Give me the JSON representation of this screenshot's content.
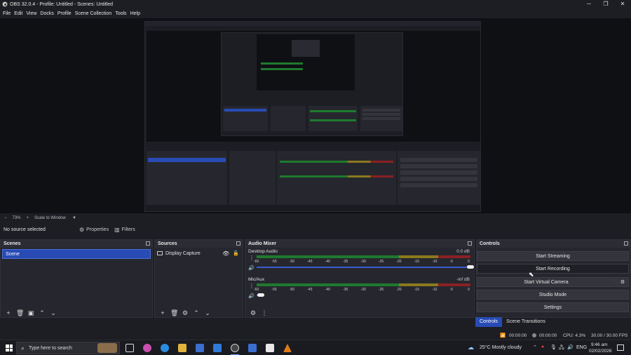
{
  "window": {
    "title": "OBS 32.0.4 - Profile: Untitled - Scenes: Untitled",
    "minimize": "─",
    "maximize": "❐",
    "close": "✕"
  },
  "menu": [
    "File",
    "Edit",
    "View",
    "Docks",
    "Profile",
    "Scene Collection",
    "Tools",
    "Help"
  ],
  "zoom": {
    "minus": "−",
    "level": "73%",
    "plus": "+",
    "mode": "Scale to Window"
  },
  "properties_bar": {
    "no_source": "No source selected",
    "properties": "Properties",
    "filters": "Filters"
  },
  "scenes": {
    "title": "Scenes",
    "items": [
      "Scene"
    ]
  },
  "sources": {
    "title": "Sources",
    "items": [
      {
        "name": "Display Capture"
      }
    ]
  },
  "audio": {
    "title": "Audio Mixer",
    "ticks": [
      "-60",
      "-55",
      "-50",
      "-45",
      "-40",
      "-35",
      "-30",
      "-25",
      "-20",
      "-15",
      "-10",
      "-5",
      "0"
    ],
    "channels": [
      {
        "name": "Desktop Audio",
        "db": "0.0 dB",
        "volume": 1.0
      },
      {
        "name": "Mic/Aux",
        "db": "-inf dB",
        "volume": 0.02
      }
    ]
  },
  "controls": {
    "title": "Controls",
    "buttons": [
      "Start Streaming",
      "Start Recording",
      "Start Virtual Camera",
      "Studio Mode",
      "Settings"
    ],
    "tabs": [
      "Controls",
      "Scene Transitions"
    ]
  },
  "status": {
    "stream_time": "00:00:00",
    "rec_time": "00:00:00",
    "cpu": "CPU: 4.3%",
    "fps": "30.00 / 30.00 FPS"
  },
  "taskbar": {
    "search_placeholder": "Type here to search",
    "weather": "25°C  Mostly cloudy",
    "lang": "ENG",
    "time": "9:46 am",
    "date": "02/02/2026"
  },
  "colors": {
    "accent": "#284bb5",
    "bg": "#1d1e24",
    "panel": "#26272e",
    "meter_green": "#1e7a2e",
    "meter_yellow": "#8a7a1d",
    "meter_red": "#8a2024"
  }
}
